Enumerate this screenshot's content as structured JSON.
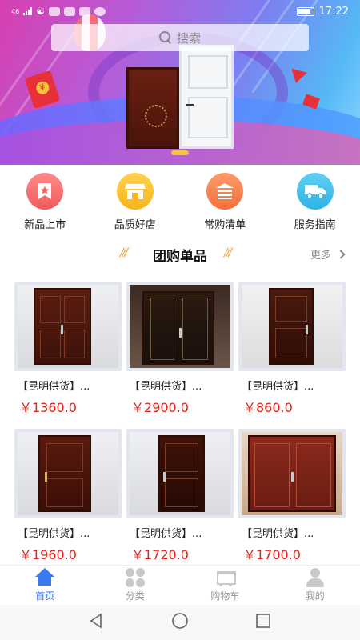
{
  "status_bar": {
    "signal": "46",
    "time": "17:22"
  },
  "search": {
    "placeholder": "搜索"
  },
  "categories": [
    {
      "label": "新品上市",
      "icon": "bookmark-star-icon",
      "color": "#f15b5b"
    },
    {
      "label": "品质好店",
      "icon": "storefront-icon",
      "color": "#f7b41c"
    },
    {
      "label": "常购清单",
      "icon": "list-icon",
      "color": "#f3703c"
    },
    {
      "label": "服务指南",
      "icon": "delivery-truck-icon",
      "color": "#2fb3e6"
    }
  ],
  "section": {
    "title": "团购单品",
    "more_label": "更多"
  },
  "products": [
    {
      "name": "【昆明供货】...",
      "price": "￥1360.0"
    },
    {
      "name": "【昆明供货】...",
      "price": "￥2900.0"
    },
    {
      "name": "【昆明供货】...",
      "price": "￥860.0"
    },
    {
      "name": "【昆明供货】...",
      "price": "￥1960.0"
    },
    {
      "name": "【昆明供货】...",
      "price": "￥1720.0"
    },
    {
      "name": "【昆明供货】...",
      "price": "￥1700.0"
    }
  ],
  "tabbar": [
    {
      "label": "首页",
      "icon": "home-icon",
      "active": true
    },
    {
      "label": "分类",
      "icon": "category-icon",
      "active": false
    },
    {
      "label": "购物车",
      "icon": "cart-icon",
      "active": false
    },
    {
      "label": "我的",
      "icon": "profile-icon",
      "active": false
    }
  ],
  "colors": {
    "accent": "#3b7bf0",
    "price": "#e2231a",
    "section_slash": "#e9a23b"
  }
}
